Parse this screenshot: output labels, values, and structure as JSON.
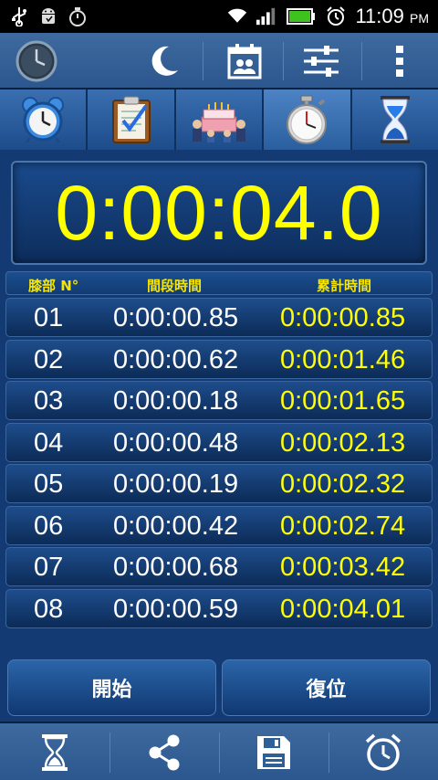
{
  "status_bar": {
    "time": "11:09",
    "ampm": "PM",
    "icons": [
      "usb-icon",
      "android-debug-icon",
      "stopwatch-notification-icon",
      "wifi-icon",
      "signal-icon",
      "battery-icon",
      "alarm-icon"
    ]
  },
  "action_bar": {
    "icons": [
      "clock-app-icon",
      "night-mode-icon",
      "calendar-contacts-icon",
      "settings-sliders-icon",
      "overflow-menu-icon"
    ]
  },
  "tabs": [
    {
      "name": "alarm-clock-tab",
      "icon": "alarm-clock-icon"
    },
    {
      "name": "checklist-tab",
      "icon": "clipboard-check-icon"
    },
    {
      "name": "birthday-tab",
      "icon": "birthday-cake-icon"
    },
    {
      "name": "stopwatch-tab",
      "icon": "stopwatch-icon",
      "active": true
    },
    {
      "name": "timer-tab",
      "icon": "hourglass-icon"
    }
  ],
  "display": {
    "time": "0:00:04.0"
  },
  "table": {
    "headers": {
      "lap": "膝部 N°",
      "split": "間段時間",
      "total": "累計時間"
    },
    "rows": [
      {
        "num": "01",
        "split": "0:00:00.85",
        "total": "0:00:00.85"
      },
      {
        "num": "02",
        "split": "0:00:00.62",
        "total": "0:00:01.46"
      },
      {
        "num": "03",
        "split": "0:00:00.18",
        "total": "0:00:01.65"
      },
      {
        "num": "04",
        "split": "0:00:00.48",
        "total": "0:00:02.13"
      },
      {
        "num": "05",
        "split": "0:00:00.19",
        "total": "0:00:02.32"
      },
      {
        "num": "06",
        "split": "0:00:00.42",
        "total": "0:00:02.74"
      },
      {
        "num": "07",
        "split": "0:00:00.68",
        "total": "0:00:03.42"
      },
      {
        "num": "08",
        "split": "0:00:00.59",
        "total": "0:00:04.01"
      }
    ]
  },
  "buttons": {
    "start": "開始",
    "reset": "復位"
  },
  "bottom_bar": {
    "icons": [
      "hourglass-icon",
      "share-icon",
      "save-icon",
      "alarm-icon"
    ]
  },
  "colors": {
    "accent_yellow": "#ffff00",
    "background": "#143a73"
  }
}
